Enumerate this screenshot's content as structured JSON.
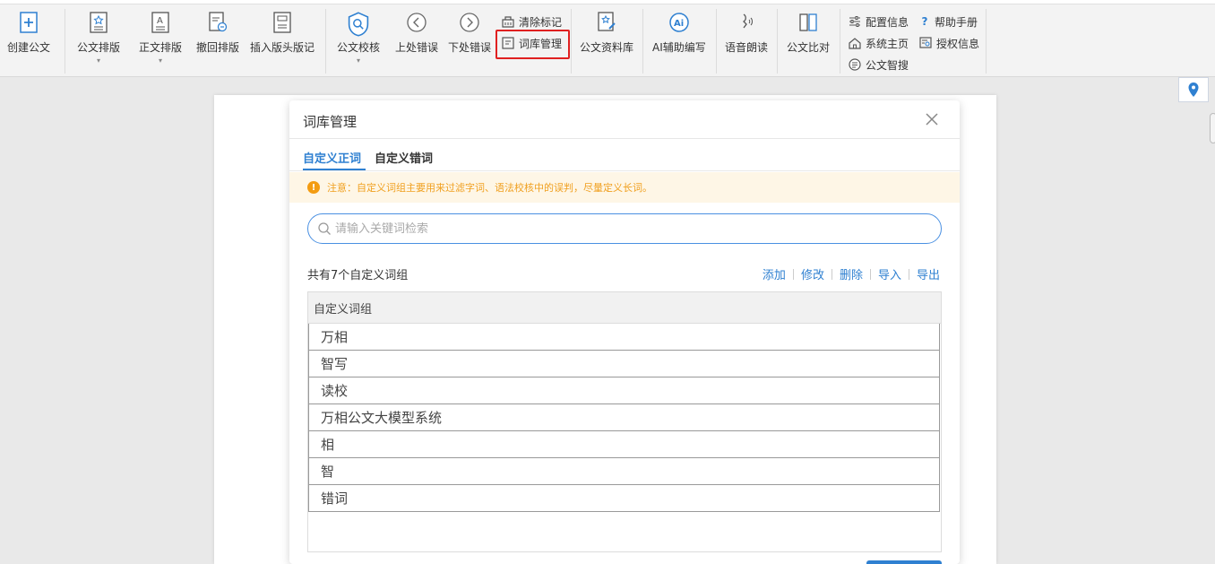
{
  "ribbon": {
    "create_doc": "创建公文",
    "doc_layout": "公文排版",
    "body_layout": "正文排版",
    "undo_layout": "撤回排版",
    "insert_header": "插入版头版记",
    "proofread": "公文校核",
    "prev_error": "上处错误",
    "next_error": "下处错误",
    "clear_marks": "清除标记",
    "lexicon_mgmt": "词库管理",
    "doc_library": "公文资料库",
    "ai_write": "AI辅助编写",
    "voice_read": "语音朗读",
    "doc_compare": "公文比对",
    "config_info": "配置信息",
    "help_manual": "帮助手册",
    "system_home": "系统主页",
    "license_info": "授权信息",
    "smart_search": "公文智搜"
  },
  "dialog": {
    "title": "词库管理",
    "tabs": [
      "自定义正词",
      "自定义错词"
    ],
    "notice": "注意：自定义词组主要用来过滤字词、语法校核中的误判，尽量定义长词。",
    "search_placeholder": "请输入关键词检索",
    "count_text": "共有7个自定义词组",
    "actions": [
      "添加",
      "修改",
      "删除",
      "导入",
      "导出"
    ],
    "table_header": "自定义词组",
    "rows": [
      "万相",
      "智写",
      "读校",
      "万相公文大模型系统",
      "相",
      "智",
      "错词"
    ]
  },
  "colors": {
    "accent": "#2f80d1",
    "warning": "#f39c12",
    "highlight": "#e02020"
  }
}
